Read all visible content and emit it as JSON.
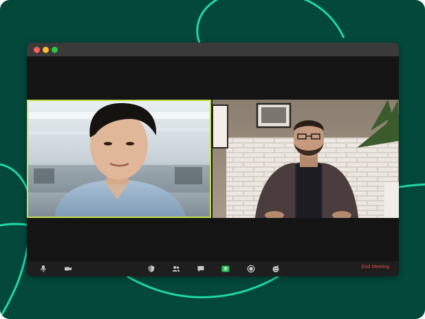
{
  "colors": {
    "background": "#03483b",
    "accent_lines": "#1fd9a4",
    "window_bg": "#141414",
    "titlebar": "#3a3a3a",
    "toolbar": "#1e1e1e",
    "active_speaker_border": "#c5e04c",
    "end_meeting": "#e5533a",
    "share_screen_button": "#2fc35f"
  },
  "window": {
    "traffic_lights": [
      "close",
      "minimize",
      "zoom"
    ]
  },
  "participants": [
    {
      "id": "participant-1",
      "active_speaker": true
    },
    {
      "id": "participant-2",
      "active_speaker": false
    }
  ],
  "toolbar": {
    "left_icons": [
      "microphone-icon",
      "camera-icon"
    ],
    "center_icons": [
      "security-icon",
      "participants-icon",
      "chat-icon",
      "share-screen-icon",
      "record-icon",
      "reactions-icon"
    ],
    "end_meeting_label": "End Meeting"
  }
}
